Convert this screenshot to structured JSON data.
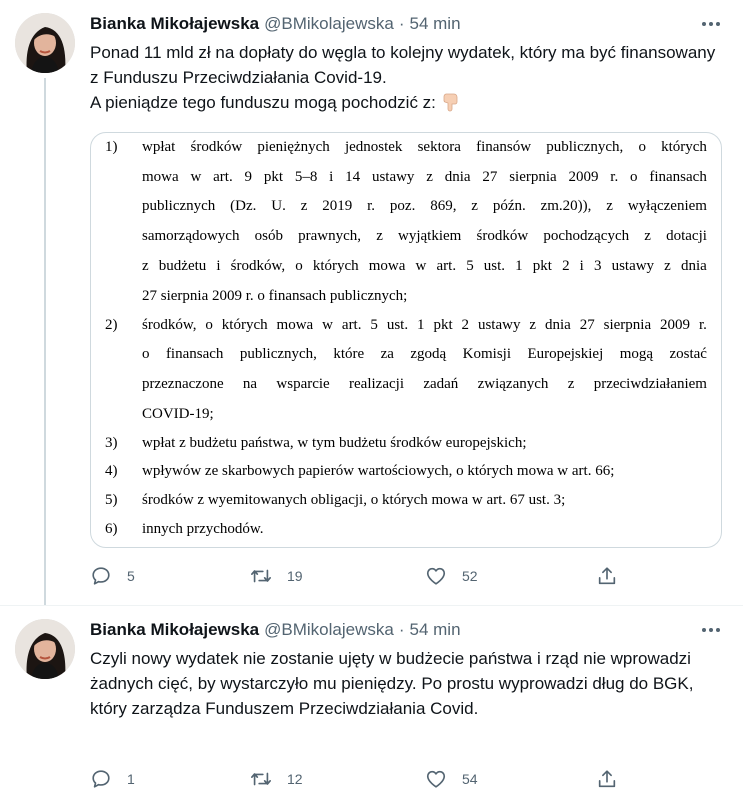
{
  "tweets": [
    {
      "author_name": "Bianka Mikołajewska",
      "handle": "@BMikolajewska",
      "separator": "·",
      "time": "54 min",
      "text": "Ponad 11 mld zł na dopłaty do węgla to kolejny wydatek, który ma być finansowany z Funduszu Przeciwdziałania Covid-19.\nA pieniądze tego funduszu mogą pochodzić z:",
      "emoji": "backhand-index-pointing-down",
      "stats": {
        "replies": "5",
        "retweets": "19",
        "likes": "52"
      }
    },
    {
      "author_name": "Bianka Mikołajewska",
      "handle": "@BMikolajewska",
      "separator": "·",
      "time": "54 min",
      "text": "Czyli nowy wydatek nie zostanie ujęty w budżecie państwa i rząd nie wprowadzi żadnych cięć, by wystarczyło mu pieniędzy. Po prostu wyprowadzi dług do BGK, który zarządza Funduszem Przeciwdziałania Covid.",
      "stats": {
        "replies": "1",
        "retweets": "12",
        "likes": "54"
      }
    }
  ],
  "document": {
    "items": [
      {
        "num": "1)",
        "lines": [
          "wpłat środków pieniężnych jednostek sektora finansów publicznych, o których",
          "mowa w art. 9 pkt 5–8 i 14 ustawy z dnia 27 sierpnia 2009 r. o finansach",
          "publicznych (Dz. U. z 2019 r. poz. 869, z późn. zm.20)), z wyłączeniem",
          "samorządowych osób prawnych, z wyjątkiem środków pochodzących z dotacji",
          "z budżetu i środków, o których mowa w art. 5 ust. 1 pkt 2 i 3 ustawy z dnia",
          "27 sierpnia 2009 r. o finansach publicznych;"
        ]
      },
      {
        "num": "2)",
        "lines": [
          "środków, o których mowa w art. 5 ust. 1 pkt 2 ustawy z dnia 27 sierpnia 2009 r.",
          "o finansach publicznych, które za zgodą Komisji Europejskiej mogą zostać",
          "przeznaczone na wsparcie realizacji zadań związanych z przeciwdziałaniem",
          "COVID-19;"
        ]
      },
      {
        "num": "3)",
        "lines": [
          "wpłat z budżetu państwa, w tym budżetu środków europejskich;"
        ]
      },
      {
        "num": "4)",
        "lines": [
          "wpływów ze skarbowych papierów wartościowych, o których mowa w art. 66;"
        ]
      },
      {
        "num": "5)",
        "lines": [
          "środków z wyemitowanych obligacji, o których mowa w art. 67 ust. 3;"
        ]
      },
      {
        "num": "6)",
        "lines": [
          "innych przychodów."
        ]
      }
    ]
  },
  "icons": {
    "reply": "reply-icon",
    "retweet": "retweet-icon",
    "like": "heart-icon",
    "share": "share-icon",
    "more": "more-icon"
  },
  "colors": {
    "text": "#0f1419",
    "secondary": "#536471",
    "border": "#cfd9de"
  }
}
